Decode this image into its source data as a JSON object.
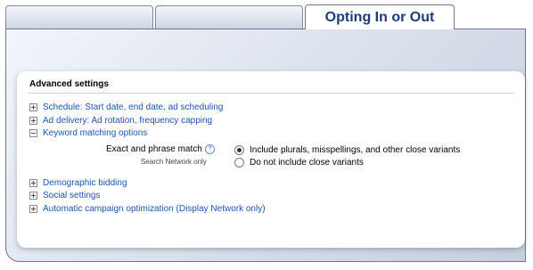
{
  "tabs": [
    {
      "label": ""
    },
    {
      "label": ""
    },
    {
      "label": "Opting In or Out"
    }
  ],
  "section_title": "Advanced settings",
  "collapsed_items_top": [
    {
      "label": "Schedule: Start date, end date, ad scheduling"
    },
    {
      "label": "Ad delivery: Ad rotation, frequency capping"
    }
  ],
  "expanded_item": {
    "label": "Keyword matching options"
  },
  "match_setting": {
    "label": "Exact and phrase match",
    "help_glyph": "?",
    "sublabel": "Search Network only",
    "options": [
      {
        "label": "Include plurals, misspellings, and other close variants",
        "selected": true
      },
      {
        "label": "Do not include close variants",
        "selected": false
      }
    ]
  },
  "collapsed_items_bottom": [
    {
      "label": "Demographic bidding"
    },
    {
      "label": "Social settings"
    },
    {
      "label": "Automatic campaign optimization (Display Network only)"
    }
  ],
  "colors": {
    "link": "#1a55b5",
    "tab_title": "#1e3a78",
    "panel_border": "#6c7790"
  }
}
